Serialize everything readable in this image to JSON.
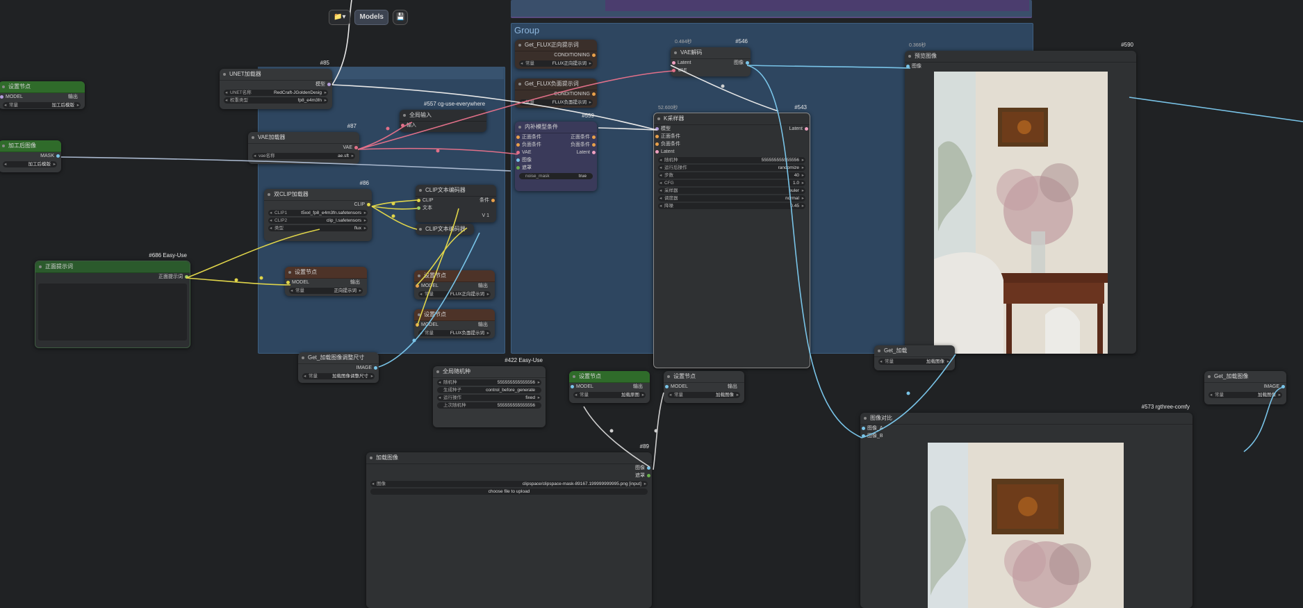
{
  "toolbar": {
    "folder_icon": "folder-icon",
    "models_label": "Models",
    "save_icon": "save-icon"
  },
  "groups": {
    "main_title": "Group"
  },
  "colors": {
    "clip_wire": "#e0d54a",
    "vae_wire": "#e27089",
    "image_wire": "#79c4e8",
    "white_wire": "#e8e8e8",
    "model_wire": "#b39ddb",
    "group_blue": "#38536f",
    "green_title": "#2f6b2a",
    "brown_title": "#4d3328"
  },
  "nodes": {
    "set_left": {
      "title": "设置节点",
      "in": "MODEL",
      "out": "输出",
      "widget_label": "常量",
      "widget_value": "加工后模版"
    },
    "proc_left": {
      "title": "加工后图像",
      "out": "MASK",
      "widget_value": "加工后模版"
    },
    "unet": {
      "id": "#85",
      "title": "UNET加载器",
      "out": "模型",
      "w1_label": "UNET名称",
      "w1_value": "RedCraft-JGoldenDesig",
      "w2_label": "权重类型",
      "w2_value": "fp8_e4m3fn"
    },
    "vae_loader": {
      "id": "#87",
      "title": "VAE加载器",
      "out": "VAE",
      "w1_label": "vae名称",
      "w1_value": "ae.sft"
    },
    "dual_clip": {
      "id": "#86",
      "title": "双CLIP加载器",
      "out": "CLIP",
      "w1_label": "CLIP1",
      "w1_value": "t5xxl_fp8_e4m3fn.safetensors",
      "w2_label": "CLIP2",
      "w2_value": "clip_l.safetensors",
      "w3_label": "类型",
      "w3_value": "flux"
    },
    "anywhere": {
      "id": "#557 cg-use-everywhere",
      "title": "全局输入",
      "in": "输入"
    },
    "clip_enc1": {
      "title": "CLIP文本编码器",
      "in1": "CLIP",
      "in2": "文本",
      "out": "条件",
      "value": "V 1"
    },
    "clip_enc2": {
      "title": "CLIP文本编码器"
    },
    "pos_prompt": {
      "id": "#686 Easy-Use",
      "title": "正面提示词",
      "out": "正面提示词"
    },
    "set_model2": {
      "title": "设置节点",
      "in": "MODEL",
      "out": "输出",
      "widget_label": "常量",
      "widget_value": "正向提示词"
    },
    "set_flux_pos": {
      "title": "设置节点",
      "in": "MODEL",
      "out": "输出",
      "widget_label": "常量",
      "widget_value": "FLUX正向提示词"
    },
    "set_flux_neg": {
      "title": "设置节点",
      "in": "MODEL",
      "out": "输出",
      "widget_label": "常量",
      "widget_value": "FLUX负面提示词"
    },
    "get_img_size": {
      "title": "Get_加载图像调整尺寸",
      "out": "IMAGE",
      "widget_label": "常量",
      "widget_value": "加载图像调整尺寸"
    },
    "get_flux_pos": {
      "title": "Get_FLUX正向提示词",
      "out": "CONDITIONING",
      "widget_label": "常量",
      "widget_value": "FLUX正向提示词"
    },
    "get_flux_neg": {
      "title": "Get_FLUX负面提示词",
      "out": "CONDITIONING",
      "widget_label": "常量",
      "widget_value": "FLUX负面提示词"
    },
    "inpaint": {
      "id": "#559",
      "title": "内补模型条件",
      "in1": "正面条件",
      "in2": "负面条件",
      "in3": "VAE",
      "in4": "图像",
      "in5": "遮罩",
      "out1": "正面条件",
      "out2": "负面条件",
      "out3": "Latent",
      "w_label": "noise_mask",
      "w_value": "true"
    },
    "vae_decode": {
      "id": "#546",
      "top": "0.484秒",
      "title": "VAE解码",
      "in1": "Latent",
      "in2": "VAE",
      "out": "图像"
    },
    "ksampler": {
      "id": "#543",
      "top": "52.600秒",
      "title": "K采样器",
      "in1": "模型",
      "in2": "正面条件",
      "in3": "负面条件",
      "in4": "Latent",
      "out": "Latent",
      "widgets": [
        {
          "label": "随机种",
          "value": "555555555555556"
        },
        {
          "label": "运行后操作",
          "value": "randomize"
        },
        {
          "label": "步数",
          "value": "40"
        },
        {
          "label": "CFG",
          "value": "1.0"
        },
        {
          "label": "采样器",
          "value": "euler"
        },
        {
          "label": "调度器",
          "value": "normal"
        },
        {
          "label": "降噪",
          "value": "0.45"
        }
      ]
    },
    "preview": {
      "id": "#590",
      "top": "0.366秒",
      "title": "预览图像",
      "in": "图像"
    },
    "seed": {
      "id": "#422 Easy-Use",
      "title": "全局随机种",
      "w1_label": "随机种",
      "w1_value": "555555555555556",
      "w2_label": "生成种子",
      "w2_value": "control_before_generate",
      "w3_label": "运行操作",
      "w3_value": "fixed",
      "w4_label": "上次随机种",
      "w4_value": "555555555555556"
    },
    "set_green": {
      "title": "设置节点",
      "in": "MODEL",
      "out": "输出",
      "widget_label": "常量",
      "widget_value": "加载原图"
    },
    "set_gray": {
      "title": "设置节点",
      "in": "MODEL",
      "out": "输出",
      "widget_label": "常量",
      "widget_value": "加载图像"
    },
    "load_image": {
      "id": "#89",
      "title": "加载图像",
      "out1": "图像",
      "out2": "遮罩",
      "w_label": "图像",
      "w_value": "clipspace/clipspace-mask-89167.199999999995.png [input]",
      "upload_label": "choose file to upload"
    },
    "get_load_a": {
      "title": "Get_加载",
      "widget_label": "常量",
      "widget_value": "加载图像"
    },
    "compare": {
      "id": "#573 rgthree-comfy",
      "title": "图像对比",
      "in1": "图像_A",
      "in2": "图像_B"
    },
    "get_load_b": {
      "title": "Get_加载图像",
      "out": "IMAGE",
      "widget_label": "常量",
      "widget_value": "加载图像"
    }
  }
}
